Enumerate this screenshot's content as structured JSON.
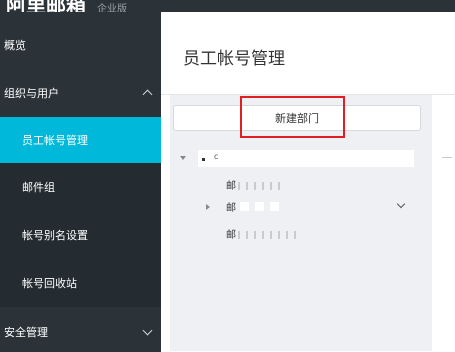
{
  "app": {
    "logo": "阿里邮箱",
    "logo_sub": "企业版"
  },
  "sidebar": {
    "overview": "概览",
    "org_group": "组织与用户",
    "items": [
      {
        "label": "员工帐号管理",
        "active": true
      },
      {
        "label": "邮件组",
        "active": false
      },
      {
        "label": "帐号别名设置",
        "active": false
      },
      {
        "label": "帐号回收站",
        "active": false
      }
    ],
    "security_group": "安全管理"
  },
  "main": {
    "title": "员工帐号管理",
    "new_dept_button": "新建部门",
    "tree": {
      "root_label": "c",
      "children": [
        {
          "label": "邮"
        },
        {
          "label": "邮"
        },
        {
          "label": "邮"
        }
      ]
    }
  },
  "colors": {
    "sidebar_bg": "#2b3339",
    "active_bg": "#00b8d9",
    "highlight": "#e02020",
    "panel_bg": "#eef0f3"
  }
}
